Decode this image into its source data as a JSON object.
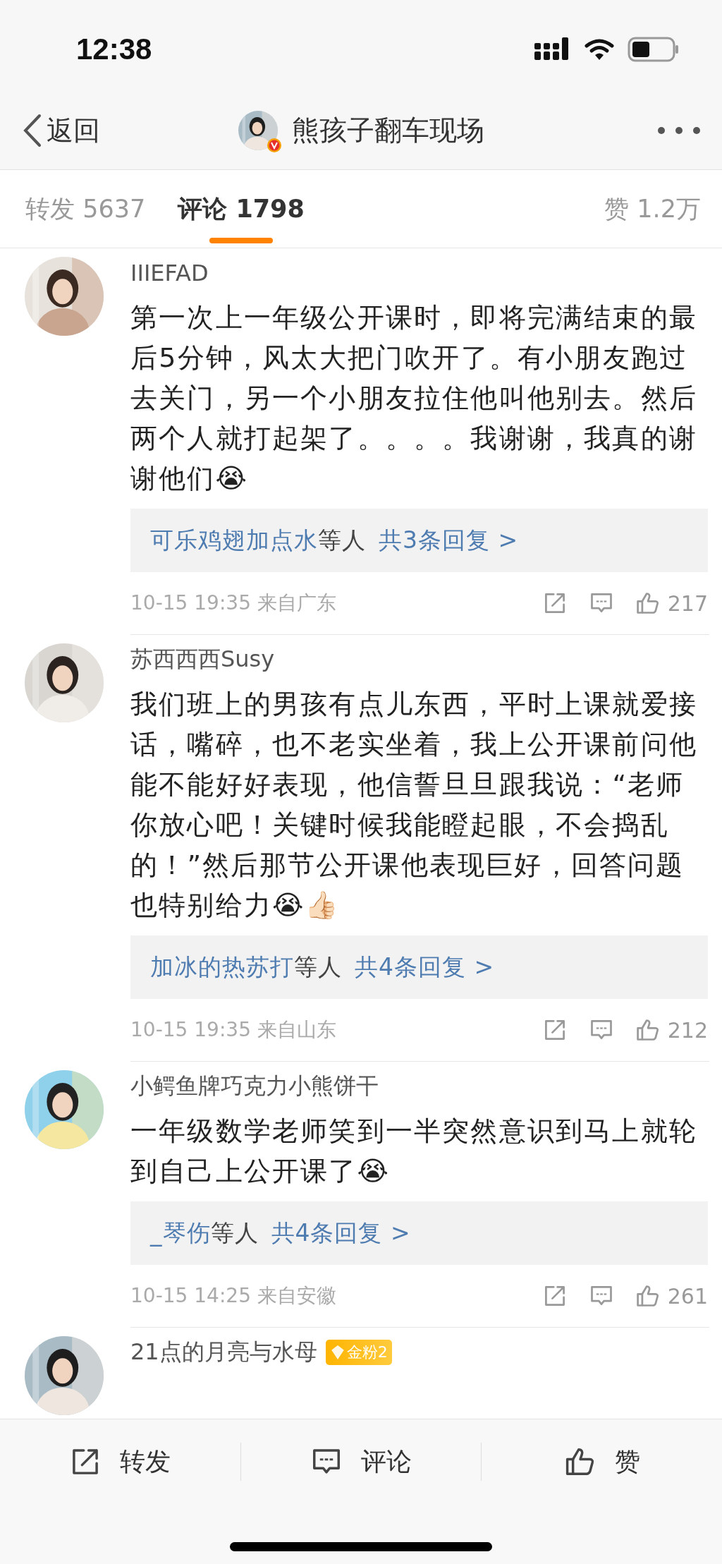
{
  "status_bar": {
    "time": "12:38"
  },
  "nav": {
    "back_label": "返回",
    "title": "熊孩子翻车现场",
    "verified": true
  },
  "tabs": [
    {
      "label": "转发",
      "count": "5637",
      "selected": false
    },
    {
      "label": "评论",
      "count": "1798",
      "selected": true
    }
  ],
  "likes": {
    "label": "赞",
    "count": "1.2万"
  },
  "comments": [
    {
      "name": "IIIEFAD",
      "text": "第一次上一年级公开课时，即将完满结束的最后5分钟，风太大把门吹开了。有小朋友跑过去关门，另一个小朋友拉住他叫他别去。然后两个人就打起架了。。。。我谢谢，我真的谢谢他们😭",
      "replies": {
        "names": "可乐鸡翅加点水",
        "suffix": "等人",
        "total": "共3条回复 >"
      },
      "time": "10-15 19:35",
      "location": "来自广东",
      "like_count": "217"
    },
    {
      "name": "苏西西西Susy",
      "text": "我们班上的男孩有点儿东西，平时上课就爱接话，嘴碎，也不老实坐着，我上公开课前问他能不能好好表现，他信誓旦旦跟我说：“老师你放心吧！关键时候我能瞪起眼，不会捣乱的！”然后那节公开课他表现巨好，回答问题也特别给力😭👍🏻",
      "replies": {
        "names": "加冰的热苏打",
        "suffix": "等人",
        "total": "共4条回复 >"
      },
      "time": "10-15 19:35",
      "location": "来自山东",
      "like_count": "212"
    },
    {
      "name": "小鳄鱼牌巧克力小熊饼干",
      "text": "一年级数学老师笑到一半突然意识到马上就轮到自己上公开课了😭",
      "replies": {
        "names": "_琴伤",
        "suffix": "等人",
        "total": "共4条回复 >"
      },
      "time": "10-15 14:25",
      "location": "来自安徽",
      "like_count": "261"
    },
    {
      "name": "21点的月亮与水母",
      "badge": {
        "label": "金粉2"
      }
    }
  ],
  "bottom_bar": [
    {
      "kind": "repost",
      "label": "转发"
    },
    {
      "kind": "comment",
      "label": "评论"
    },
    {
      "kind": "like",
      "label": "赞"
    }
  ]
}
